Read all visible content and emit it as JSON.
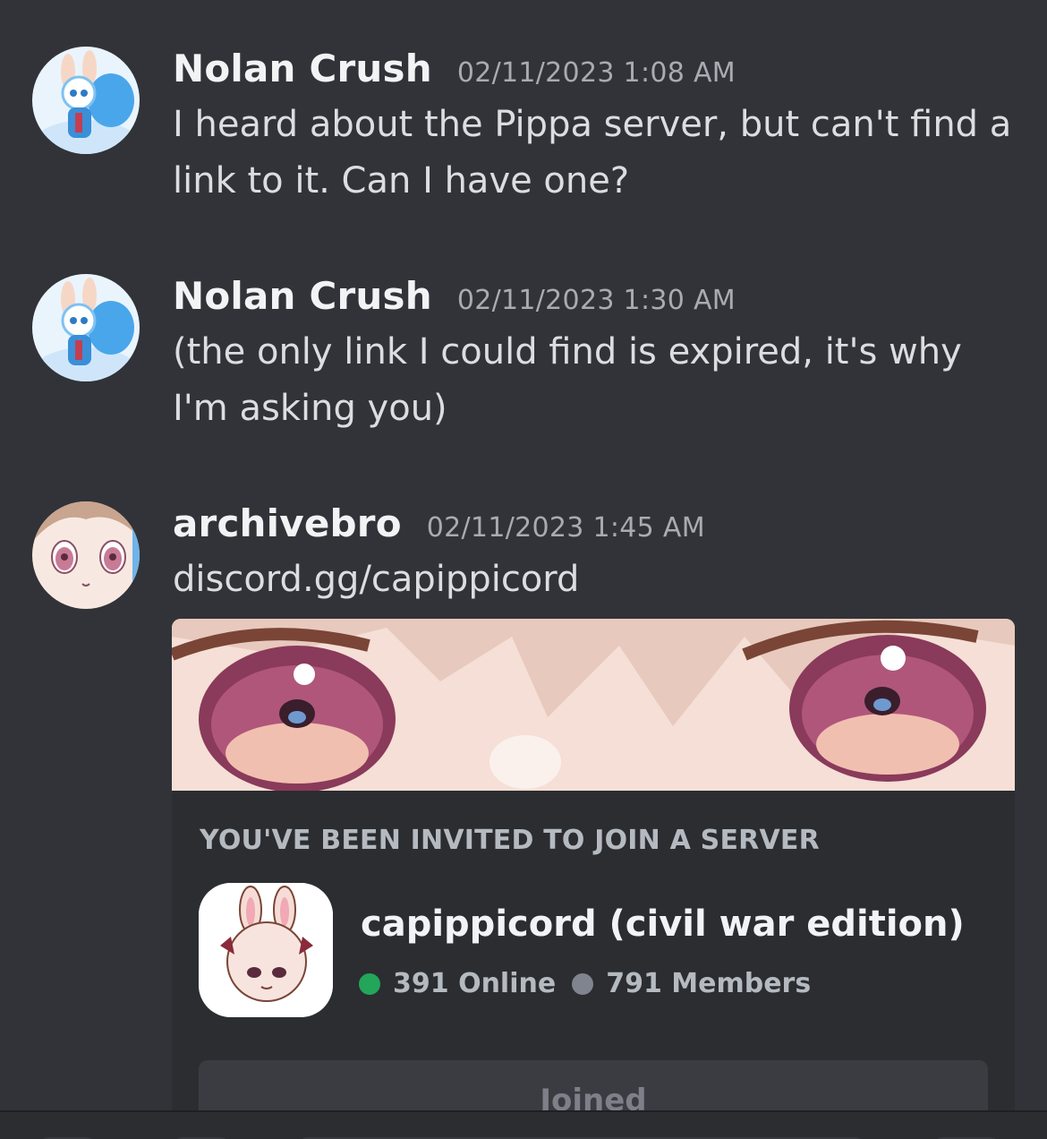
{
  "messages": [
    {
      "username": "Nolan Crush",
      "timestamp": "02/11/2023 1:08 AM",
      "lines": [
        "I heard about the Pippa server, but can't find a",
        "link to it. Can I have one?"
      ]
    },
    {
      "username": "Nolan Crush",
      "timestamp": "02/11/2023 1:30 AM",
      "lines": [
        "(the only link I could find is expired, it's why",
        "I'm asking you)"
      ]
    },
    {
      "username": "archivebro",
      "timestamp": "02/11/2023 1:45 AM",
      "link": "discord.gg/capippicord"
    }
  ],
  "invite": {
    "label": "YOU'VE BEEN INVITED TO JOIN A SERVER",
    "server_name": "capippicord (civil war edition)",
    "online": "391 Online",
    "members": "791 Members",
    "button": "Joined"
  },
  "colors": {
    "background": "#313338",
    "online_dot": "#23a55a",
    "members_dot": "#80848e"
  }
}
